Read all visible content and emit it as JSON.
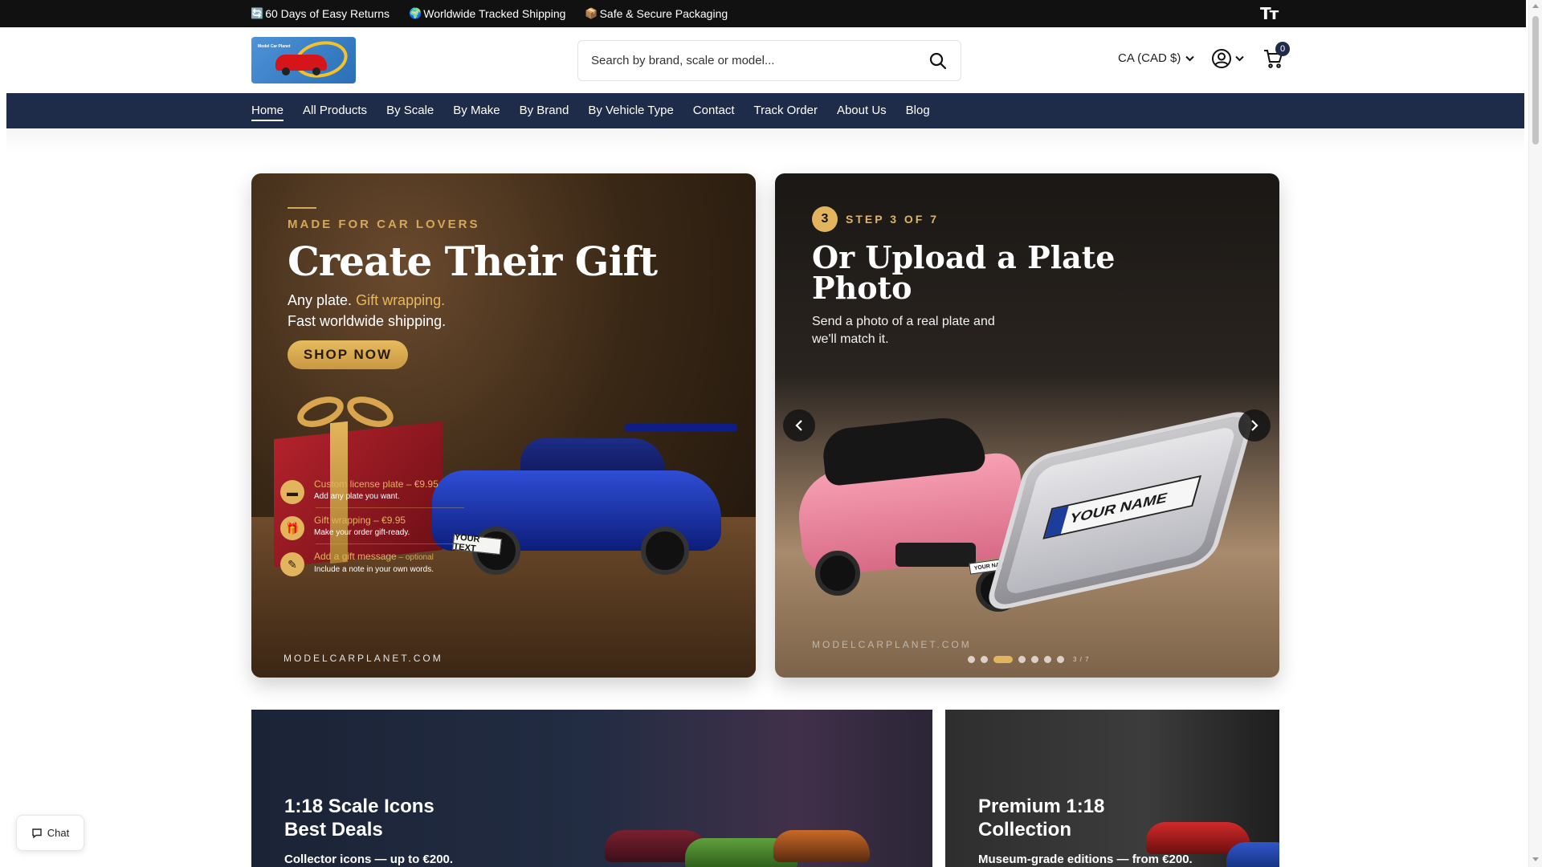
{
  "announcement": {
    "items": [
      {
        "icon": "🔄",
        "text": "60 Days of Easy Returns"
      },
      {
        "icon": "🌍",
        "text": "Worldwide Tracked Shipping"
      },
      {
        "icon": "📦",
        "text": "Safe & Secure Packaging"
      }
    ],
    "text_size_icon": "Tт"
  },
  "header": {
    "logo_text": "Model Car Planet",
    "search_placeholder": "Search by brand, scale or model...",
    "currency": "CA (CAD $)",
    "cart_count": "0"
  },
  "nav": {
    "items": [
      "Home",
      "All Products",
      "By Scale",
      "By Make",
      "By Brand",
      "By Vehicle Type",
      "Contact",
      "Track Order",
      "About Us",
      "Blog"
    ],
    "active": "Home"
  },
  "hero_left": {
    "eyebrow": "MADE FOR CAR LOVERS",
    "title": "Create Their Gift",
    "sub_line1_a": "Any plate. ",
    "sub_line1_b": "Gift wrapping.",
    "sub_line2": "Fast worldwide shipping.",
    "cta": "SHOP NOW",
    "car_plate": "YOUR TEXT",
    "features": [
      {
        "icon": "card-icon",
        "title": "Custom license plate – €9.95",
        "desc": "Add any plate you want."
      },
      {
        "icon": "gift-icon",
        "title": "Gift wrapping – €9.95",
        "desc": "Make your order gift-ready."
      },
      {
        "icon": "pencil-icon",
        "title": "Add a gift message",
        "optional": " – optional",
        "desc": "Include a note in your own words."
      }
    ],
    "domain": "MODELCARPLANET.COM"
  },
  "hero_right": {
    "step_number": "3",
    "step_label": "STEP 3 OF 7",
    "title": "Or Upload a Plate Photo",
    "sub": "Send a photo of a real plate and we'll match it.",
    "phone_plate": "YOUR NAME",
    "car_plate": "YOUR NAME",
    "domain": "MODELCARPLANET.COM",
    "slide_counter": "3 / 7",
    "slide_total": 7,
    "slide_active": 3
  },
  "promos": [
    {
      "title_line1": "1:18 Scale Icons",
      "title_line2": "Best Deals",
      "sub": "Collector icons — up to €200."
    },
    {
      "title_line1": "Premium 1:18",
      "title_line2": "Collection",
      "sub": "Museum-grade editions — from €200."
    }
  ],
  "chat": {
    "label": "Chat"
  },
  "colors": {
    "nav_bg": "#1e2c4a",
    "gold": "#e1b45d",
    "announce_bg": "#111111"
  }
}
